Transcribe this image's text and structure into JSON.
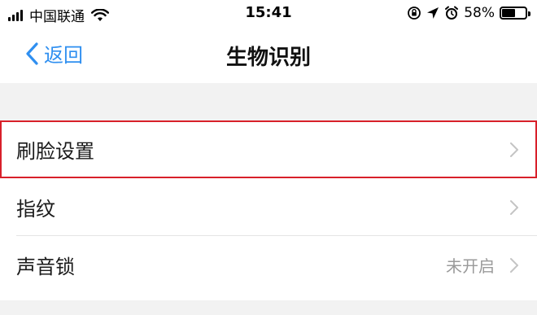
{
  "status_bar": {
    "carrier": "中国联通",
    "time": "15:41",
    "battery_percent": "58%",
    "battery_level": 0.58
  },
  "nav": {
    "back_label": "返回",
    "title": "生物识别"
  },
  "settings": {
    "items": [
      {
        "label": "刷脸设置",
        "value": "",
        "highlighted": true
      },
      {
        "label": "指纹",
        "value": ""
      },
      {
        "label": "声音锁",
        "value": "未开启"
      }
    ]
  },
  "colors": {
    "accent": "#2f8ff0",
    "highlight_border": "#d8202a",
    "separator_bg": "#f2f2f2",
    "secondary_text": "#9a9a9a"
  }
}
